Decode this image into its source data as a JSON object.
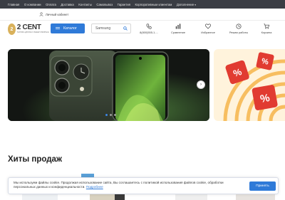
{
  "topnav": {
    "items": [
      "Главная",
      "О компании",
      "Оплата",
      "Доставка",
      "Контакты",
      "Самовывоз",
      "Гарантия",
      "Корпоративным клиентам",
      "Дополнение"
    ],
    "more_caret": "▾"
  },
  "account": {
    "label": "Личный кабинет"
  },
  "logo": {
    "badge": "2",
    "name": "2 CENT",
    "tagline": "ТЕХНИКА ДЛЯ ВАС И ВАШЕГО БИЗНЕСА"
  },
  "catalog": {
    "label": "Каталог"
  },
  "search": {
    "placeholder": "Samsung"
  },
  "header_icons": [
    {
      "icon": "phone-icon",
      "label": "8(800)555-1-..."
    },
    {
      "icon": "compare-icon",
      "label": "Сравнение"
    },
    {
      "icon": "heart-icon",
      "label": "Избранное"
    },
    {
      "icon": "clock-icon",
      "label": "Режим работы"
    },
    {
      "icon": "cart-icon",
      "label": "Корзина"
    }
  ],
  "banner": {
    "dots": 3,
    "active_dot": 0,
    "next_glyph": "›"
  },
  "section": {
    "title": "Хиты продаж"
  },
  "cookie": {
    "text": "Мы используем файлы cookie. Продолжая использование сайта, Вы соглашаетесь с политикой использования файлов cookie, обработки персональных данных и конфиденциальности.",
    "link": "Подробнее",
    "button": "Принять"
  },
  "colors": {
    "accent": "#2f7ad8",
    "topnav_bg": "#3a3d44",
    "logo_gold": "#d9b15b"
  }
}
